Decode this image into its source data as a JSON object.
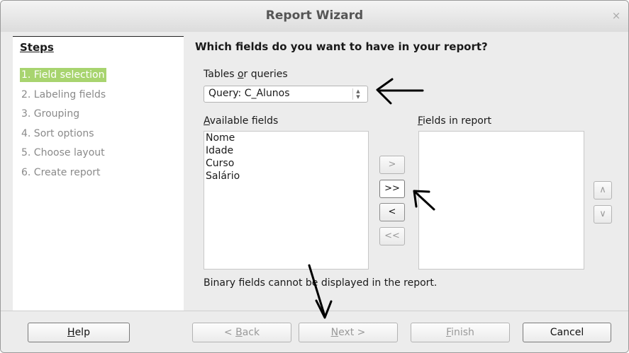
{
  "window": {
    "title": "Report Wizard",
    "close_glyph": "×"
  },
  "steps": {
    "heading": "Steps",
    "items": [
      {
        "label": "1. Field selection",
        "active": true
      },
      {
        "label": "2. Labeling fields",
        "active": false
      },
      {
        "label": "3. Grouping",
        "active": false
      },
      {
        "label": "4. Sort options",
        "active": false
      },
      {
        "label": "5. Choose layout",
        "active": false
      },
      {
        "label": "6. Create report",
        "active": false
      }
    ]
  },
  "main": {
    "question": "Which fields do you want to have in your report?",
    "tables_label_pre": "Tables ",
    "tables_label_u": "o",
    "tables_label_post": "r queries",
    "combo_value": "Query: C_Alunos",
    "available_label_u": "A",
    "available_label_rest": "vailable fields",
    "available_fields": [
      "Nome",
      "Idade",
      "Curso",
      "Salário"
    ],
    "in_report_label_u": "F",
    "in_report_label_rest": "ields in report",
    "in_report_fields": [],
    "move_buttons": {
      "add_one": ">",
      "add_all": ">>",
      "remove_one": "<",
      "remove_all": "<<"
    },
    "order_buttons": {
      "up": "∧",
      "down": "∨"
    },
    "binary_note": "Binary fields cannot be displayed in the report."
  },
  "footer": {
    "help_u": "H",
    "help_rest": "elp",
    "back_pre": "< ",
    "back_u": "B",
    "back_rest": "ack",
    "next_u": "N",
    "next_rest": "ext >",
    "finish_u": "F",
    "finish_rest": "inish",
    "cancel": "Cancel"
  }
}
